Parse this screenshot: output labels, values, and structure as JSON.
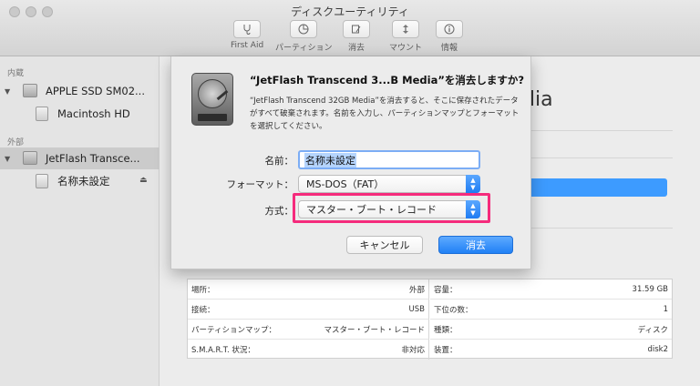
{
  "window": {
    "title": "ディスクユーティリティ"
  },
  "toolbar": {
    "items": [
      {
        "label": "First Aid",
        "icon": "stethoscope-icon"
      },
      {
        "label": "パーティション",
        "icon": "pie-chart-icon"
      },
      {
        "label": "消去",
        "icon": "eraser-icon"
      },
      {
        "label": "マウント",
        "icon": "mount-icon"
      },
      {
        "label": "情報",
        "icon": "info-icon"
      }
    ]
  },
  "sidebar": {
    "internal_header": "内蔵",
    "external_header": "外部",
    "items": [
      {
        "label": "APPLE SSD SM02...",
        "icon": "internal-disk-icon"
      },
      {
        "label": "Macintosh HD",
        "icon": "volume-icon"
      },
      {
        "label": "JetFlash Transce...",
        "icon": "external-disk-icon",
        "selected": true
      },
      {
        "label": "名称未設定",
        "icon": "volume-icon"
      }
    ]
  },
  "main": {
    "title_fragment": "dia"
  },
  "dialog": {
    "title": "“JetFlash Transcend 3...B Media”を消去しますか?",
    "message": "“JetFlash Transcend 32GB Media”を消去すると、そこに保存されたデータがすべて破棄されます。名前を入力し、パーティションマップとフォーマットを選択してください。",
    "name_label": "名前：",
    "name_value": "名称未設定",
    "format_label": "フォーマット：",
    "format_value": "MS-DOS（FAT）",
    "scheme_label": "方式：",
    "scheme_value": "マスター・ブート・レコード",
    "cancel_label": "キャンセル",
    "erase_label": "消去"
  },
  "info_table": {
    "left": [
      {
        "key": "場所：",
        "value": "外部"
      },
      {
        "key": "接続：",
        "value": "USB"
      },
      {
        "key": "パーティションマップ：",
        "value": "マスター・ブート・レコード"
      },
      {
        "key": "S.M.A.R.T. 状況：",
        "value": "非対応"
      }
    ],
    "right": [
      {
        "key": "容量：",
        "value": "31.59 GB"
      },
      {
        "key": "下位の数：",
        "value": "1"
      },
      {
        "key": "種類：",
        "value": "ディスク"
      },
      {
        "key": "装置：",
        "value": "disk2"
      }
    ]
  },
  "colors": {
    "accent": "#2080f5",
    "highlight": "#f52b7c",
    "selection": "#cbcbcb"
  }
}
